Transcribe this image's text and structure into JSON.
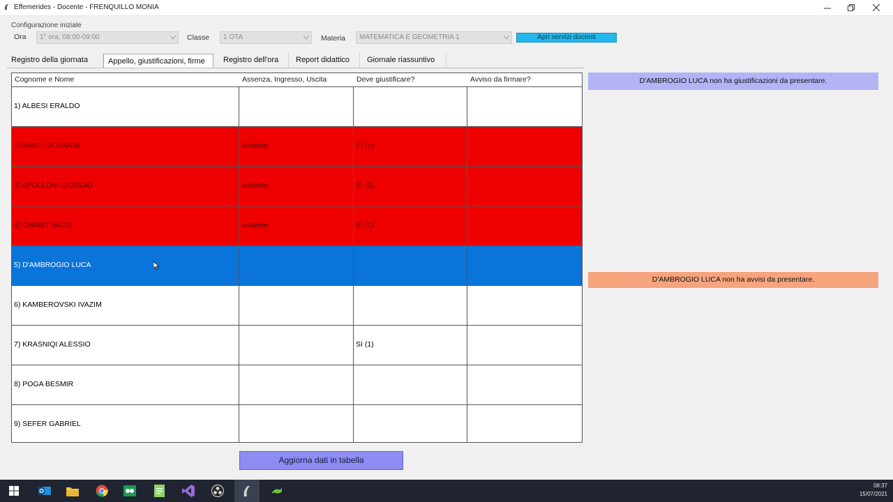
{
  "window": {
    "title": "Effemerides - Docente - FRENQUILLO MONIA"
  },
  "config": {
    "group_label": "Configurazione iniziale",
    "ora_label": "Ora",
    "ora_value": "1° ora, 08:00-09:00",
    "classe_label": "Classe",
    "classe_value": "1 OTA",
    "materia_label": "Materia",
    "materia_value": "MATEMATICA E GEOMETRIA 1",
    "services_button": "Apri servizi docenti"
  },
  "tabs": [
    {
      "label": "Registro della giornata"
    },
    {
      "label": "Appello, giustificazioni, firme"
    },
    {
      "label": "Registro dell'ora"
    },
    {
      "label": "Report didattico"
    },
    {
      "label": "Giornale riassuntivo"
    }
  ],
  "table": {
    "headers": [
      "Cognome e Nome",
      "Assenza, Ingresso, Uscita",
      "Deve giustificare?",
      "Avviso da firmare?"
    ],
    "rows": [
      {
        "name": "1) ALBESI ERALDO",
        "assenza": "",
        "giustificare": "",
        "avviso": "",
        "state": "normal"
      },
      {
        "name": "2) AMICI GIOVANNI",
        "assenza": "Assente",
        "giustificare": "Sì (1)",
        "avviso": "",
        "state": "absent"
      },
      {
        "name": "3) APOLLONI GIORGIO",
        "assenza": "Assente",
        "giustificare": "Sì (2)",
        "avviso": "",
        "state": "absent"
      },
      {
        "name": "4) CHABIT VALID",
        "assenza": "Assente",
        "giustificare": "Sì (1)",
        "avviso": "",
        "state": "absent"
      },
      {
        "name": "5) D'AMBROGIO LUCA",
        "assenza": "",
        "giustificare": "",
        "avviso": "",
        "state": "selected"
      },
      {
        "name": "6) KAMBEROVSKI IVAZIM",
        "assenza": "",
        "giustificare": "",
        "avviso": "",
        "state": "normal"
      },
      {
        "name": "7) KRASNIQI ALESSIO",
        "assenza": "",
        "giustificare": "Sì (1)",
        "avviso": "",
        "state": "normal"
      },
      {
        "name": "8) POGA BESMIR",
        "assenza": "",
        "giustificare": "",
        "avviso": "",
        "state": "normal"
      },
      {
        "name": "9) SEFER GABRIEL",
        "assenza": "",
        "giustificare": "",
        "avviso": "",
        "state": "normal"
      }
    ]
  },
  "panels": {
    "justifications_msg": "D'AMBROGIO LUCA non ha giustificazioni da presentare.",
    "notices_msg": "D'AMBROGIO LUCA non ha avvisi da presentare."
  },
  "update_button": "Aggiorna dati in tabella",
  "taskbar": {
    "time": "08:37",
    "date": "15/07/2021"
  },
  "colors": {
    "absent_row": "#ee0000",
    "selected_row": "#0a74da",
    "justify_panel": "#b3b3f6",
    "notice_panel": "#f5a47e",
    "services_button": "#22b9ec"
  }
}
